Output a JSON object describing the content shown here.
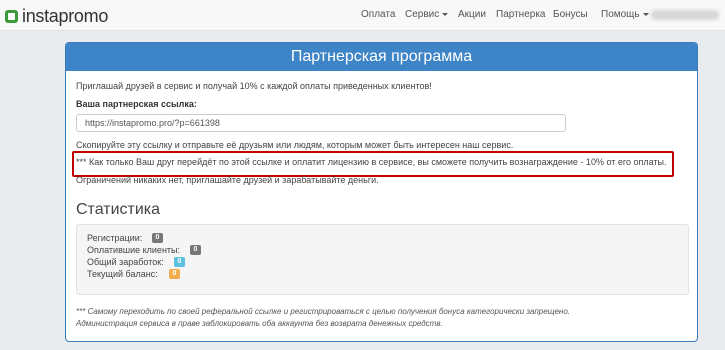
{
  "brand": {
    "name": "instapromo"
  },
  "nav": {
    "items": [
      {
        "label": "Оплата"
      },
      {
        "label": "Сервис"
      },
      {
        "label": "Акции"
      },
      {
        "label": "Партнерка"
      },
      {
        "label": "Бонусы"
      },
      {
        "label": "Помощь"
      }
    ]
  },
  "page": {
    "title": "Партнерская программа",
    "intro": "Приглашай друзей в сервис и получай 10% с каждой оплаты приведенных клиентов!",
    "link_label": "Ваша партнерская ссылка:",
    "link_value": "https://instapromo.pro/?p=661398",
    "copy_hint": "Скопируйте эту ссылку и отправьте её друзьям или людям, которым может быть интересен наш сервис.",
    "reward_note": "*** Как только Ваш друг перейдёт по этой ссылке и оплатит лицензию в сервисе, вы сможете получить вознаграждение - 10% от его оплаты.",
    "limits_note": "Ограничений никаких нет, приглашайте друзей и зарабатывайте деньги."
  },
  "stats": {
    "heading": "Статистика",
    "items": [
      {
        "label": "Регистрации:",
        "value": "0",
        "color": "#777777"
      },
      {
        "label": "Оплатившие клиенты:",
        "value": "0",
        "color": "#777777"
      },
      {
        "label": "Общий заработок:",
        "value": "0",
        "color": "#5bc0de"
      },
      {
        "label": "Текущий баланс:",
        "value": "0",
        "color": "#f0ad4e"
      }
    ]
  },
  "footer_notes": [
    "*** Самому переходить по своей реферальной ссылке и регистрироваться с целью получения бонуса категорически запрещено.",
    "Администрация сервиса в праве заблокировать оба аккаунта без возврата денежных средств."
  ]
}
